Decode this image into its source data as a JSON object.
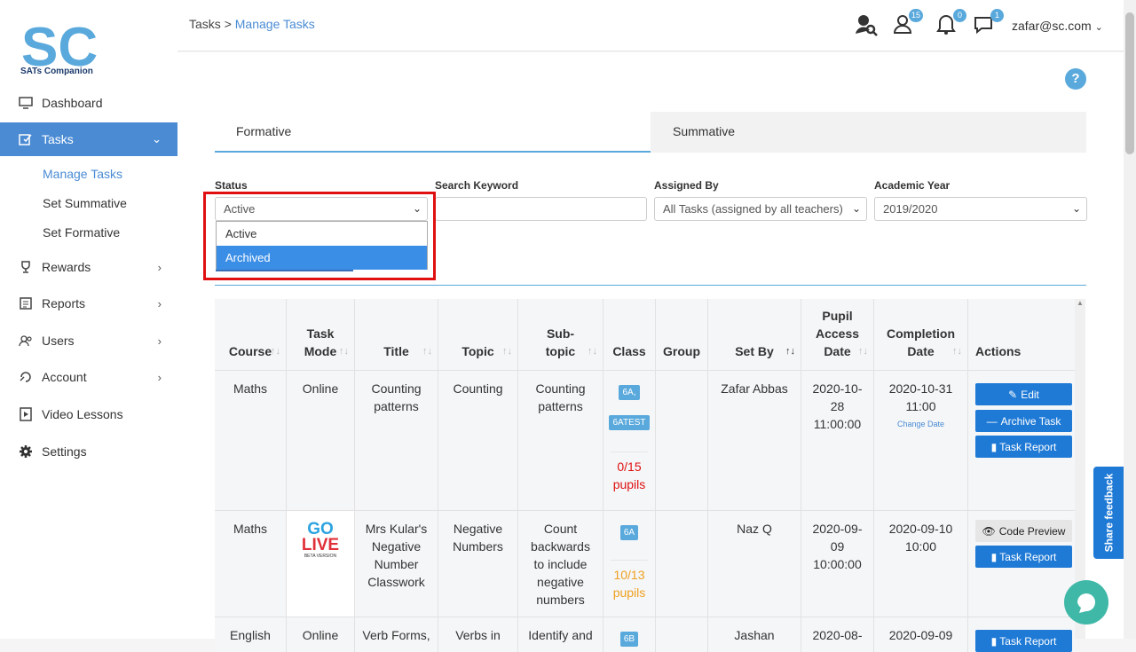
{
  "brand": {
    "logo_text": "SC",
    "subtitle": "SATs Companion"
  },
  "sidebar": {
    "items": [
      {
        "label": "Dashboard",
        "icon": "monitor-icon"
      },
      {
        "label": "Tasks",
        "icon": "task-edit-icon"
      },
      {
        "label": "Rewards",
        "icon": "trophy-icon"
      },
      {
        "label": "Reports",
        "icon": "report-icon"
      },
      {
        "label": "Users",
        "icon": "users-icon"
      },
      {
        "label": "Account",
        "icon": "account-icon"
      },
      {
        "label": "Video Lessons",
        "icon": "video-icon"
      },
      {
        "label": "Settings",
        "icon": "gear-icon"
      }
    ],
    "task_subitems": [
      "Manage Tasks",
      "Set Summative",
      "Set Formative"
    ]
  },
  "header": {
    "breadcrumb_root": "Tasks",
    "breadcrumb_sep": ">",
    "breadcrumb_current": "Manage Tasks",
    "badges": {
      "users": "15",
      "notifications": "0",
      "messages": "1"
    },
    "user_email": "zafar@sc.com"
  },
  "help_label": "?",
  "tabs": [
    "Formative",
    "Summative"
  ],
  "filters": {
    "status_label": "Status",
    "status_value": "Active",
    "status_options": [
      "Active",
      "Archived"
    ],
    "search_label": "Search Keyword",
    "search_value": "",
    "assigned_label": "Assigned By",
    "assigned_value": "All Tasks (assigned by all teachers)",
    "year_label": "Academic Year",
    "year_value": "2019/2020"
  },
  "table": {
    "headers": {
      "course": "Course",
      "task_mode_1": "Task",
      "task_mode_2": "Mode",
      "title": "Title",
      "topic": "Topic",
      "subtopic_1": "Sub-",
      "subtopic_2": "topic",
      "class": "Class",
      "group": "Group",
      "set_by": "Set By",
      "pupil_1": "Pupil",
      "pupil_2": "Access",
      "pupil_3": "Date",
      "completion_1": "Completion",
      "completion_2": "Date",
      "actions": "Actions"
    },
    "rows": [
      {
        "course": "Maths",
        "mode": "Online",
        "title": "Counting patterns",
        "topic": "Counting",
        "subtopic": "Counting patterns",
        "class_badges": [
          "6A,",
          "6ATEST"
        ],
        "pupils": "0/15 pupils",
        "set_by": "Zafar Abbas",
        "access_date": "2020-10-28 11:00:00",
        "completion_date": "2020-10-31 11:00",
        "change_date": "Change Date",
        "actions": [
          "Edit",
          "Archive Task",
          "Task Report"
        ]
      },
      {
        "course": "Maths",
        "mode_logo_top": "GO",
        "mode_logo_bottom": "LIVE",
        "mode_logo_small": "BETA VERSION",
        "title": "Mrs Kular's Negative Number Classwork",
        "topic": "Negative Numbers",
        "subtopic": "Count backwards to include negative numbers",
        "class_badges": [
          "6A"
        ],
        "pupils": "10/13 pupils",
        "set_by": "Naz Q",
        "access_date": "2020-09-09 10:00:00",
        "completion_date": "2020-09-10 10:00",
        "actions": [
          "Code Preview",
          "Task Report"
        ]
      },
      {
        "course": "English",
        "mode": "Online",
        "title": "Verb Forms,",
        "topic": "Verbs in",
        "subtopic": "Identify and",
        "class_badges": [
          "6B"
        ],
        "set_by": "Jashan",
        "access_date": "2020-08-",
        "completion_date": "2020-09-09",
        "actions": [
          "Task Report"
        ]
      }
    ]
  },
  "feedback_label": "Share feedback",
  "colors": {
    "accent": "#4a8bd4",
    "badge": "#5aa9dc",
    "button": "#1f7ad6",
    "highlight": "#e01010"
  }
}
